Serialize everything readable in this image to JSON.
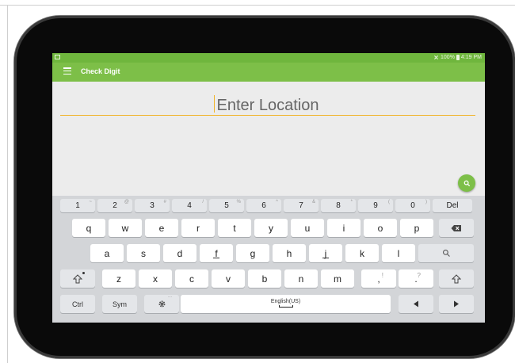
{
  "statusbar": {
    "right_text": "100%",
    "clock": "4:19 PM"
  },
  "appbar": {
    "title": "Check Digit"
  },
  "location": {
    "placeholder": "Enter Location"
  },
  "colors": {
    "accent": "#7dbf48",
    "underline": "#f0b429"
  },
  "keyboard": {
    "numrow": [
      {
        "label": "1",
        "hint": "~"
      },
      {
        "label": "2",
        "hint": "@"
      },
      {
        "label": "3",
        "hint": "#"
      },
      {
        "label": "4",
        "hint": "/"
      },
      {
        "label": "5",
        "hint": "%"
      },
      {
        "label": "6",
        "hint": "^"
      },
      {
        "label": "7",
        "hint": "&"
      },
      {
        "label": "8",
        "hint": "*"
      },
      {
        "label": "9",
        "hint": "("
      },
      {
        "label": "0",
        "hint": ")"
      }
    ],
    "del_label": "Del",
    "row1": [
      "q",
      "w",
      "e",
      "r",
      "t",
      "y",
      "u",
      "i",
      "o",
      "p"
    ],
    "row2": [
      "a",
      "s",
      "d",
      "f",
      "g",
      "h",
      "j",
      "k",
      "l"
    ],
    "row3": [
      "z",
      "x",
      "c",
      "v",
      "b",
      "n",
      "m"
    ],
    "comma_label": ",",
    "comma_hint": "!",
    "period_label": ".",
    "period_hint": "?",
    "ctrl_label": "Ctrl",
    "sym_label": "Sym",
    "settings_hint": "...",
    "space_label": "English(US)",
    "icons": {
      "backspace": "backspace-icon",
      "search": "search-icon",
      "shift": "shift-icon",
      "settings": "gear-icon",
      "left": "arrow-left-icon",
      "right": "arrow-right-icon"
    }
  }
}
